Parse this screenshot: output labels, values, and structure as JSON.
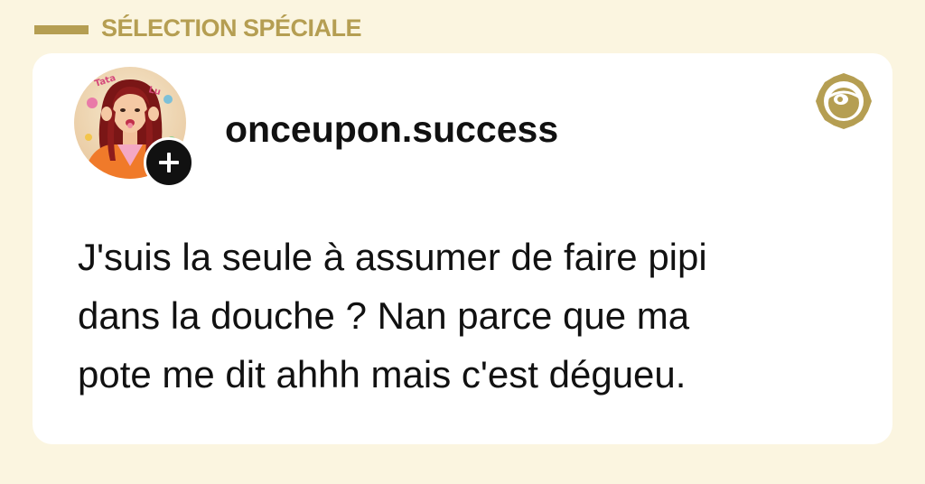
{
  "header": {
    "section_label": "SÉLECTION SPÉCIALE"
  },
  "post": {
    "username": "onceupon.success",
    "avatar_text_left": "Tata",
    "avatar_text_right": "Lu",
    "follow_icon": "plus-icon",
    "brand_icon": "brand-logo-icon",
    "text_lines": [
      "J'suis la seule à assumer de faire pipi",
      "dans la douche ? Nan parce que ma",
      "pote me dit ahhh mais c'est dégueu."
    ]
  },
  "colors": {
    "page_background": "#fbf5e0",
    "accent_gold": "#b59e52",
    "card_background": "#ffffff",
    "text": "#111111"
  }
}
